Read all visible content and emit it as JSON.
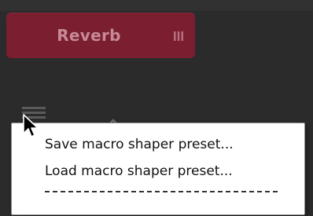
{
  "module": {
    "title": "Reverb",
    "grip_icon": "grip-bars-icon"
  },
  "toolbar": {
    "menu_icon": "hamburger-icon",
    "collapse_icon": "caret-up-icon"
  },
  "context_menu": {
    "items": [
      {
        "label": "Save macro shaper preset..."
      },
      {
        "label": "Load macro shaper preset..."
      }
    ],
    "separator": "separator-line"
  },
  "colors": {
    "panel_bg": "#2b2b2b",
    "module_bg": "#7a1e30",
    "module_text": "#c78a96",
    "menu_bg": "#ffffff",
    "menu_text": "#111111"
  }
}
